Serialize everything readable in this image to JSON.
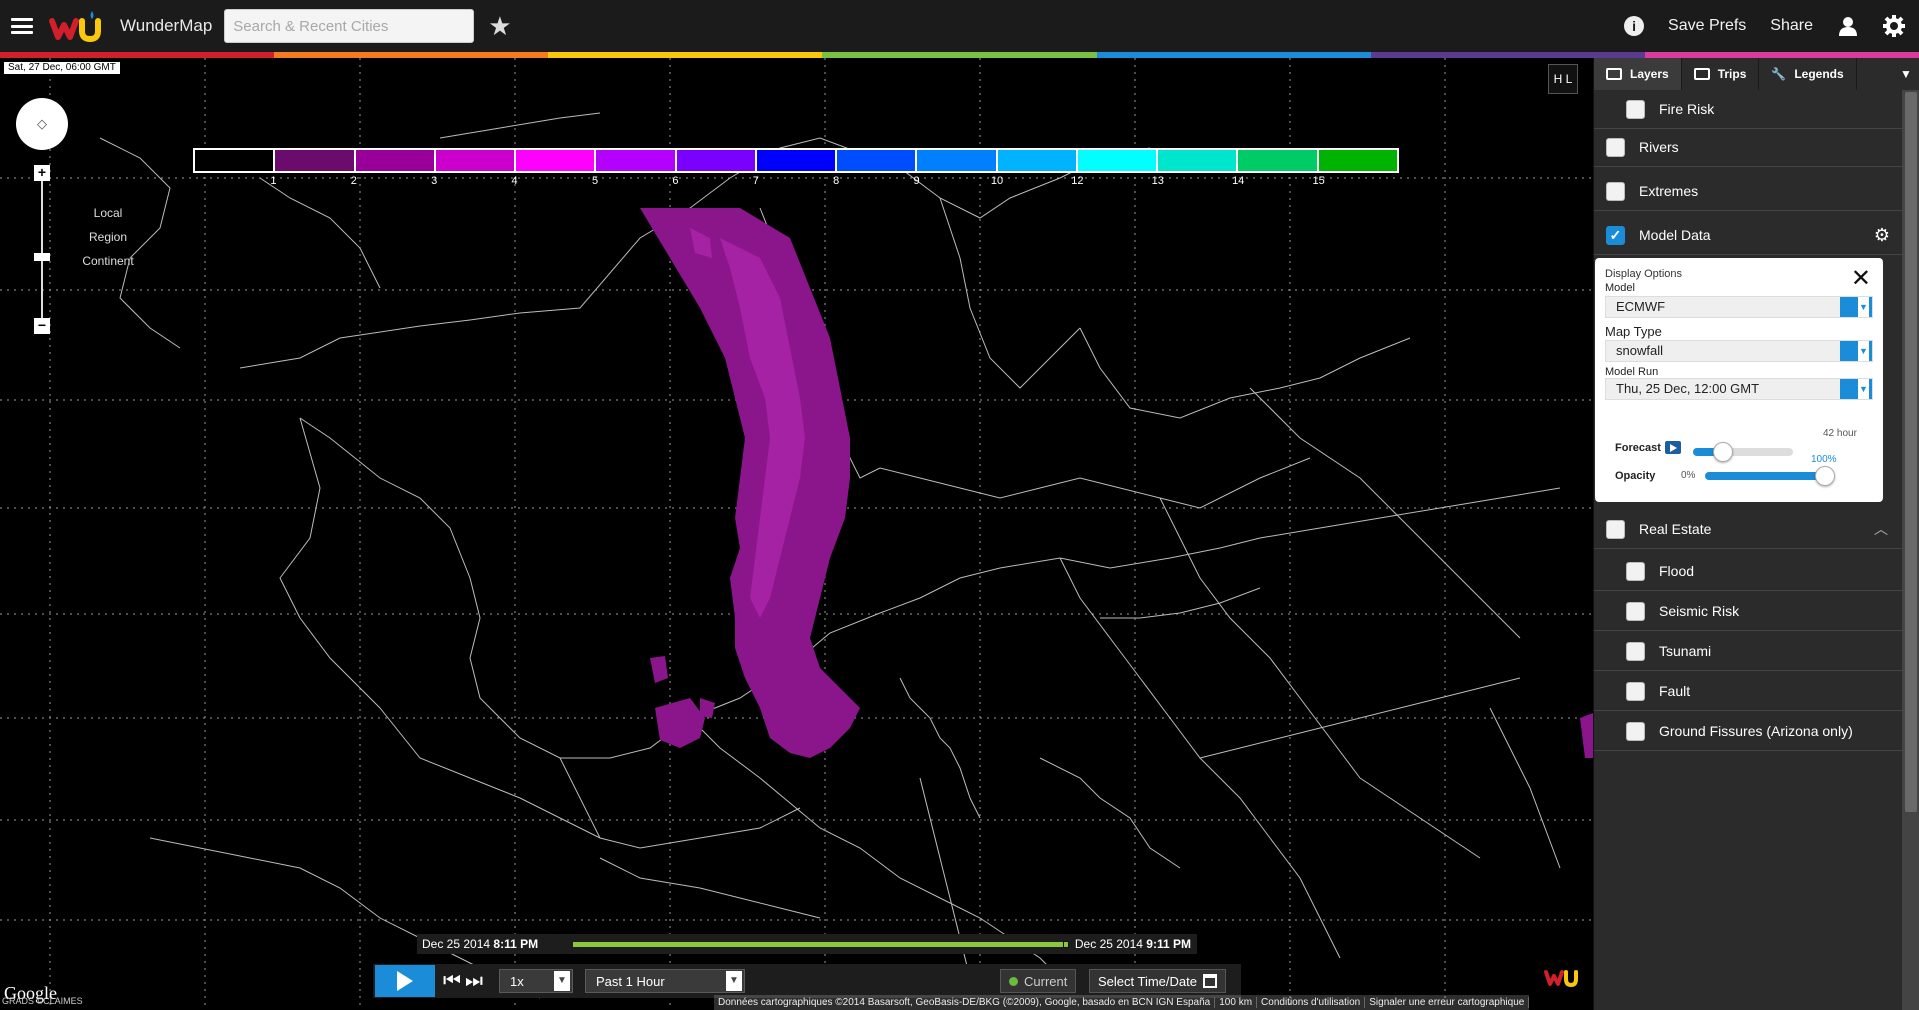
{
  "header": {
    "app_title": "WunderMap",
    "search_placeholder": "Search & Recent Cities",
    "save_prefs": "Save Prefs",
    "share": "Share"
  },
  "brand_colors": [
    "#d11f2b",
    "#f47b20",
    "#f9c70c",
    "#7ac143",
    "#1b8dd8",
    "#5b3a92",
    "#d83d9e"
  ],
  "map": {
    "timestamp": "Sat, 27 Dec, 06:00 GMT",
    "zoom_levels": [
      "Local",
      "Region",
      "Continent"
    ],
    "hl_button": "H L",
    "google_logo": "Google",
    "imagery_credit": "GRADS ©CLAIMES",
    "attribution": "Données cartographiques ©2014 Basarsoft, GeoBasis-DE/BKG (©2009), Google, basado en BCN IGN España",
    "scale": "100 km",
    "terms": "Conditions d'utilisation",
    "report": "Signaler une erreur cartographique"
  },
  "colorbar": {
    "colors": [
      "#000000",
      "#6b0b6b",
      "#990099",
      "#cc00cc",
      "#ff00ff",
      "#b300ff",
      "#7a00ff",
      "#0000ff",
      "#004dff",
      "#0080ff",
      "#00b3ff",
      "#00ffff",
      "#00e6cc",
      "#00cc66",
      "#00b300"
    ],
    "ticks": [
      "1",
      "2",
      "3",
      "4",
      "5",
      "6",
      "7",
      "8",
      "9",
      "10",
      "12",
      "13",
      "14",
      "15"
    ]
  },
  "timeline": {
    "start_date": "Dec 25 2014",
    "start_time": "8:11 PM",
    "end_date": "Dec 25 2014",
    "end_time": "9:11 PM",
    "speed": "1x",
    "range": "Past 1 Hour",
    "current": "Current",
    "select_time": "Select Time/Date"
  },
  "panel": {
    "tabs": [
      {
        "label": "Layers"
      },
      {
        "label": "Trips"
      },
      {
        "label": "Legends"
      }
    ],
    "layers_top": [
      {
        "label": "Fire Risk",
        "checked": false,
        "indent": true
      },
      {
        "label": "Rivers",
        "checked": false,
        "indent": false
      },
      {
        "label": "Extremes",
        "checked": false,
        "indent": false
      },
      {
        "label": "Model Data",
        "checked": true,
        "indent": false
      }
    ],
    "real_estate": {
      "label": "Real Estate",
      "checked": false
    },
    "layers_bottom": [
      {
        "label": "Flood",
        "checked": false
      },
      {
        "label": "Seismic Risk",
        "checked": false
      },
      {
        "label": "Tsunami",
        "checked": false
      },
      {
        "label": "Fault",
        "checked": false
      },
      {
        "label": "Ground Fissures (Arizona only)",
        "checked": false
      }
    ]
  },
  "display_options": {
    "title": "Display Options",
    "model_label": "Model",
    "model_value": "ECMWF",
    "map_type_label": "Map Type",
    "map_type_value": "snowfall",
    "model_run_label": "Model Run",
    "model_run_value": "Thu, 25 Dec, 12:00 GMT",
    "forecast_label": "Forecast",
    "forecast_value": "42 hour",
    "forecast_level": 0.3,
    "opacity_label": "Opacity",
    "opacity_min": "0%",
    "opacity_max": "100%",
    "opacity_level": 1.0
  }
}
